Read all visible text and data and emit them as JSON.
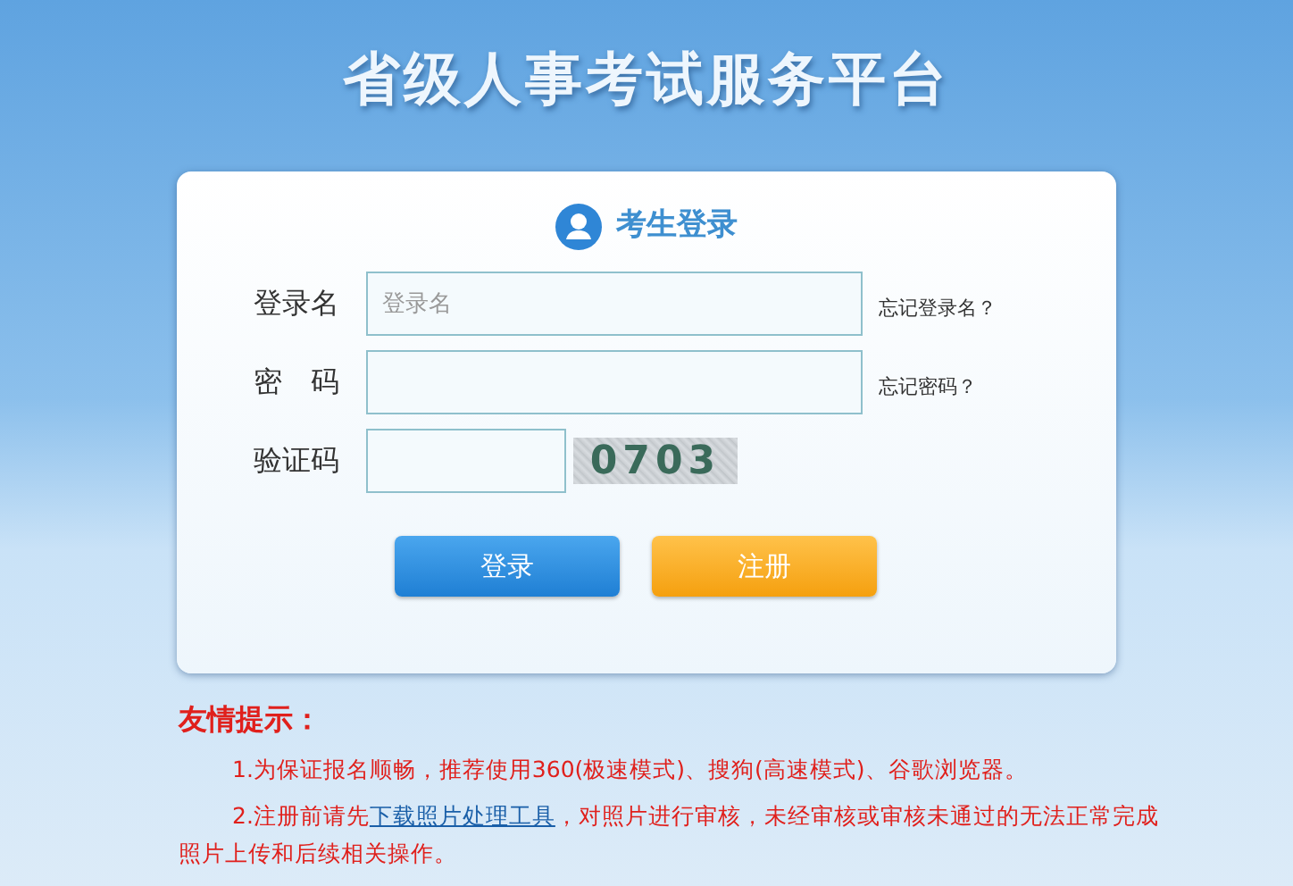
{
  "page_title": "省级人事考试服务平台",
  "login": {
    "heading": "考生登录",
    "fields": [
      {
        "kind": "text",
        "label": "登录名",
        "placeholder": "登录名",
        "link": "忘记登录名？"
      },
      {
        "kind": "password",
        "label": "密　码",
        "link": "忘记密码？"
      },
      {
        "kind": "captcha",
        "label": "验证码",
        "captcha": "0703"
      }
    ],
    "buttons": [
      {
        "kind": "primary",
        "label": "登录"
      },
      {
        "kind": "secondary",
        "label": "注册"
      }
    ]
  },
  "notice": {
    "title": "友情提示：",
    "items": [
      {
        "before": "1.为保证报名顺畅，推荐使用360(极速模式)、搜狗(高速模式)、谷歌浏览器。"
      },
      {
        "before": "2.注册前请先",
        "link": "下载照片处理工具",
        "after": "，对照片进行审核，未经审核或审核未通过的无法正常完成照片上传和后续相关操作。"
      }
    ]
  }
}
